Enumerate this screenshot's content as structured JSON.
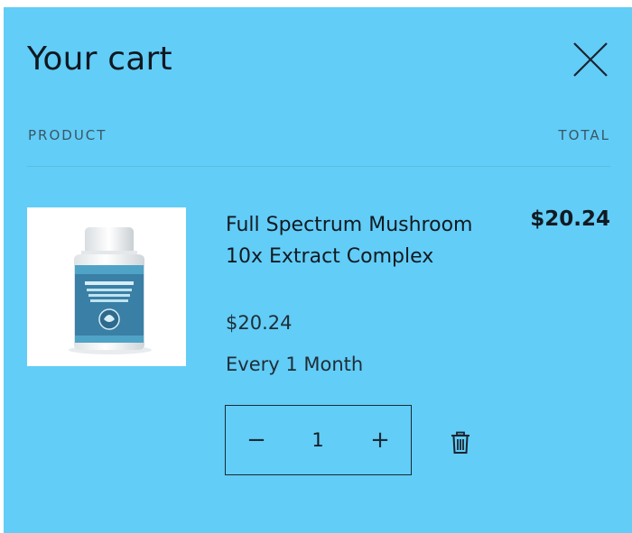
{
  "cart": {
    "title": "Your cart",
    "close_icon": "close-icon"
  },
  "table": {
    "product_header": "PRODUCT",
    "total_header": "TOTAL"
  },
  "item": {
    "name": "Full Spectrum Mushroom 10x Extract Complex",
    "price": "$20.24",
    "subscription": "Every 1 Month",
    "line_total": "$20.24",
    "quantity": "1",
    "minus_label": "−",
    "plus_label": "+",
    "image_icon": "supplement-bottle-image",
    "remove_icon": "trash-icon"
  },
  "colors": {
    "background": "#62cdf7",
    "text": "#111a22"
  }
}
